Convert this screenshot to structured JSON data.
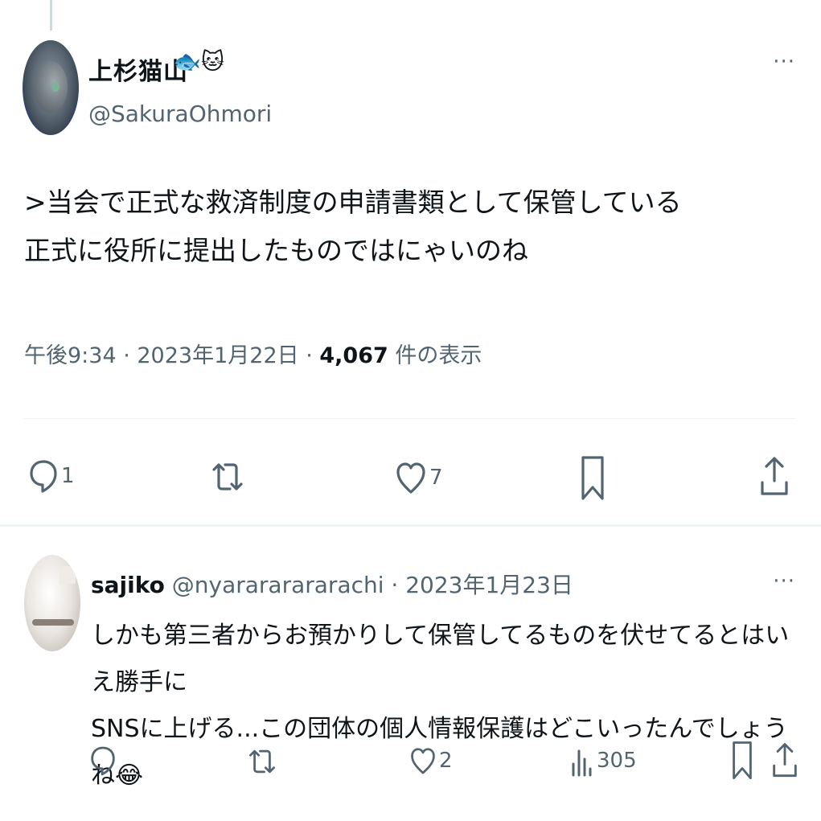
{
  "tweet": {
    "display_name": "上杉猫山",
    "name_emojis": "🐟🐱",
    "handle": "@SakuraOhmori",
    "text_lines": [
      ">当会で正式な救済制度の申請書類として保管している",
      "正式に役所に提出したものではにゃいのね"
    ],
    "meta_time_date": "午後9:34 · 2023年1月22日 · ",
    "views_count": "4,067",
    "views_label": " 件の表示",
    "more": "···",
    "actions": {
      "reply_count": "1",
      "retweet_count": "",
      "like_count": "7"
    }
  },
  "reply": {
    "display_name": "sajiko",
    "handle_date": " @nyarararararachi · 2023年1月23日",
    "text_lines": [
      "しかも第三者からお預かりして保管してるものを伏せてるとはいえ勝手に",
      "SNSに上げる...この団体の個人情報保護はどこいったんでしょうね😂"
    ],
    "more": "···",
    "actions": {
      "reply_count": "",
      "retweet_count": "",
      "like_count": "2",
      "views_count": "305"
    }
  },
  "icons": [
    "reply-icon",
    "retweet-icon",
    "like-icon",
    "bookmark-icon",
    "share-icon",
    "views-icon",
    "more-icon"
  ],
  "colors": {
    "text": "#0f1419",
    "secondary": "#536471",
    "divider": "#eff3f4"
  }
}
